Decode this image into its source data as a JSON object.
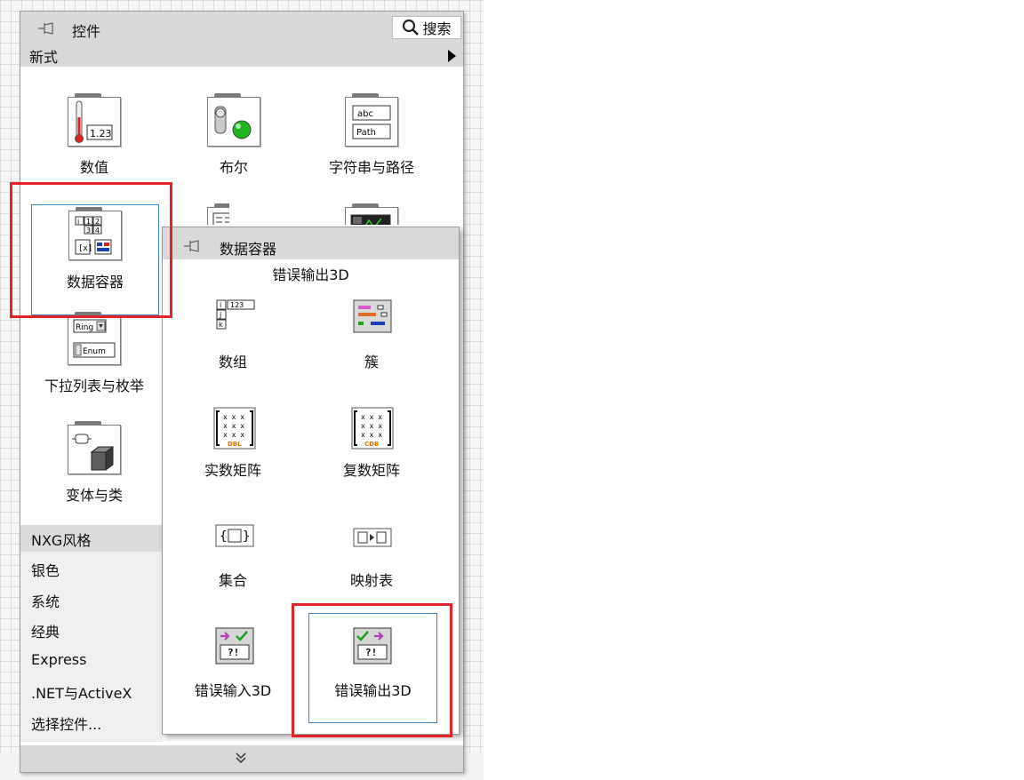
{
  "palette": {
    "title": "控件",
    "search_label": "搜索",
    "category": "新式",
    "tiles": [
      {
        "label": "数值"
      },
      {
        "label": "布尔"
      },
      {
        "label": "字符串与路径"
      },
      {
        "label": "数据容器"
      },
      {
        "label": "下拉列表与枚举"
      },
      {
        "label": "变体与类"
      }
    ],
    "numeric_readout": "1.23",
    "string_icon": {
      "top": "abc",
      "bottom": "Path"
    },
    "ring_icon": {
      "top": "Ring",
      "bottom": "Enum"
    },
    "other_categories": [
      "NXG风格",
      "银色",
      "系统",
      "经典",
      "Express",
      ".NET与ActiveX",
      "选择控件..."
    ],
    "footer_icon": "double-chevron-down-icon"
  },
  "subpalette": {
    "title": "数据容器",
    "tooltip": "错误输出3D",
    "items": [
      {
        "label": "数组"
      },
      {
        "label": "簇"
      },
      {
        "label": "实数矩阵"
      },
      {
        "label": "复数矩阵"
      },
      {
        "label": "集合"
      },
      {
        "label": "映射表"
      },
      {
        "label": "错误输入3D"
      },
      {
        "label": "错误输出3D"
      }
    ],
    "array_icon_text": "123",
    "matrix_real_tag": "DBL",
    "matrix_complex_tag": "CDB"
  },
  "colors": {
    "highlight": "#e1232b",
    "selection_frame": "#3b84c6"
  }
}
